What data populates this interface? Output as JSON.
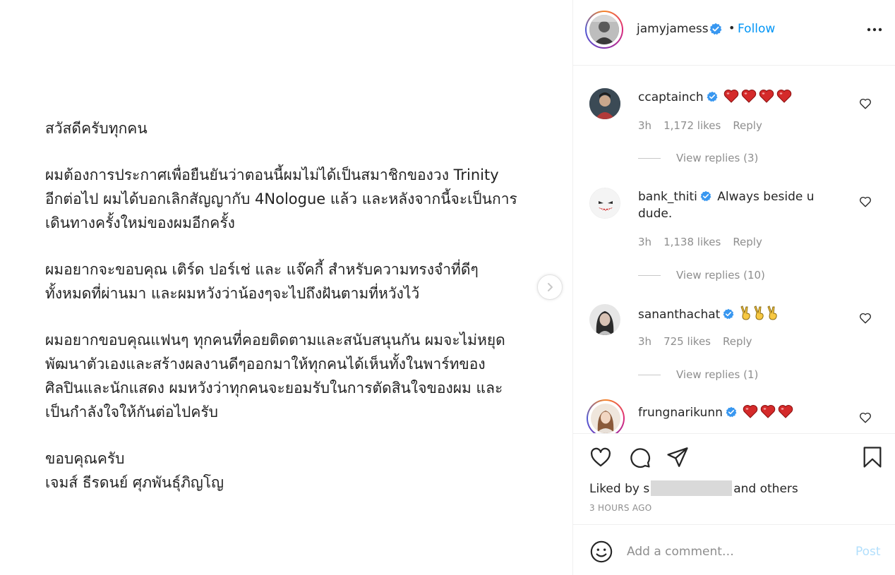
{
  "post": {
    "paragraphs": [
      "สวัสดีครับทุกคน",
      "ผมต้องการประกาศเพื่อยืนยันว่าตอนนี้ผมไม่ได้เป็นสมาชิกของวง Trinity\nอีกต่อไป ผมได้บอกเลิกสัญญากับ 4Nologue แล้ว และหลังจากนี้จะเป็นการ\nเดินทางครั้งใหม่ของผมอีกครั้ง",
      "ผมอยากจะขอบคุณ เติร์ด ปอร์เช่ และ แจ๊คกี้ สำหรับความทรงจำที่ดีๆ\nทั้งหมดที่ผ่านมา และผมหวังว่าน้องๆจะไปถึงฝันตามที่หวังไว้",
      "ผมอยากขอบคุณแฟนๆ ทุกคนที่คอยติดตามและสนับสนุนกัน ผมจะไม่หยุด\nพัฒนาตัวเองและสร้างผลงานดีๆออกมาให้ทุกคนได้เห็นทั้งในพาร์ทของ\nศิลปินและนักแสดง ผมหวังว่าทุกคนจะยอมรับในการตัดสินใจของผม และ\nเป็นกำลังใจให้กันต่อไปครับ",
      "ขอบคุณครับ\nเจมส์ ธีรดนย์ ศุภพันธุ์ภิญโญ"
    ],
    "next_icon": "chevron-right-icon"
  },
  "header": {
    "username": "jamyjamess",
    "separator": "•",
    "follow_label": "Follow",
    "more_icon": "more-horizontal-icon"
  },
  "comments": [
    {
      "username": "ccaptainch",
      "text": "",
      "emoji": [
        "red-heart",
        "red-heart",
        "red-heart",
        "red-heart"
      ],
      "time": "3h",
      "likes": "1,172 likes",
      "reply": "Reply",
      "view_replies": "View replies (3)"
    },
    {
      "username": "bank_thiti",
      "text": "Always beside u dude.",
      "emoji": [],
      "time": "3h",
      "likes": "1,138 likes",
      "reply": "Reply",
      "view_replies": "View replies (10)"
    },
    {
      "username": "sananthachat",
      "text": "",
      "emoji": [
        "victory-hand",
        "victory-hand",
        "victory-hand"
      ],
      "time": "3h",
      "likes": "725 likes",
      "reply": "Reply",
      "view_replies": "View replies (1)"
    },
    {
      "username": "frungnarikunn",
      "text": "",
      "emoji": [
        "red-heart",
        "red-heart",
        "red-heart"
      ]
    }
  ],
  "actions": {
    "liked_by_prefix": "Liked by",
    "liked_by_partial": "s",
    "liked_by_and": "and",
    "liked_by_others": "others",
    "timestamp": "3 HOURS AGO"
  },
  "add_comment": {
    "placeholder": "Add a comment…",
    "post_label": "Post"
  },
  "colors": {
    "link_blue": "#0095f6",
    "post_disabled": "#b2dffc",
    "verified_blue": "#3897f0",
    "muted": "#8e8e8e",
    "heart_red": "#ed4956"
  }
}
